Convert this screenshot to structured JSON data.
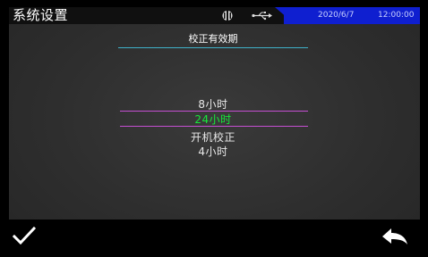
{
  "statusbar": {
    "title": "系统设置",
    "date": "2020/6/7",
    "time": "12:00:00",
    "icons": [
      "usb-icon",
      "lan-icon"
    ],
    "accent_color": "#0f1fd0"
  },
  "dialog": {
    "heading": "校正有效期",
    "options": [
      "8小时",
      "24小时",
      "开机校正",
      "4小时"
    ],
    "selected": "24小时",
    "selected_color": "#17e83a",
    "selector_color": "#c64fd3"
  },
  "bottombar": {
    "confirm_icon": "checkmark-icon",
    "back_icon": "back-arrow-icon"
  }
}
